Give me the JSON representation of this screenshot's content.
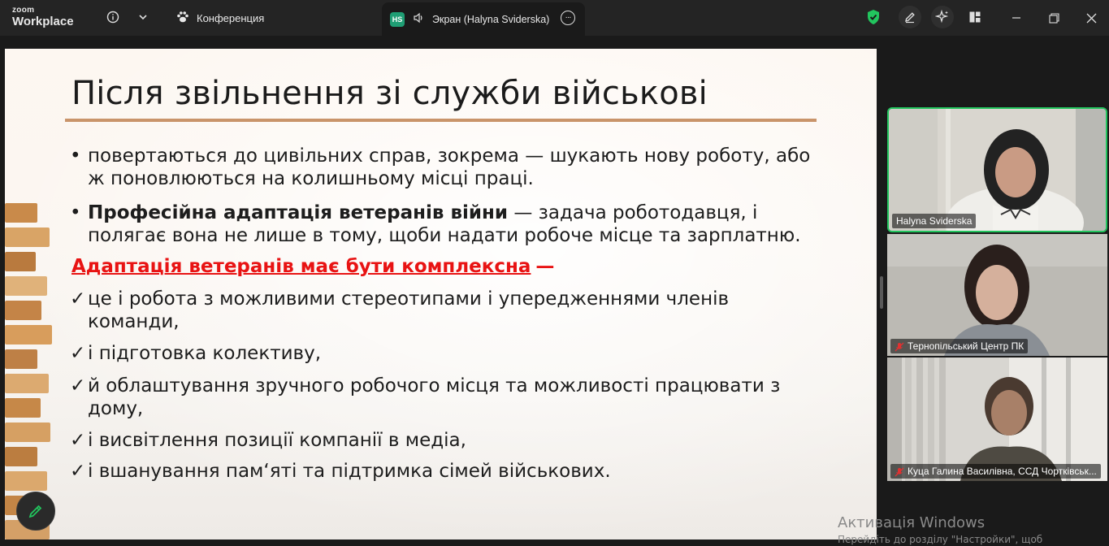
{
  "app": {
    "brand_line1": "zoom",
    "brand_line2": "Workplace"
  },
  "topbar": {
    "info_icon": "info-icon",
    "chevron_icon": "chevron-down-icon",
    "conference_tab": {
      "icon": "paw-icon",
      "label": "Конференция"
    },
    "screen_tab": {
      "badge": "HS",
      "icon": "speaker-icon",
      "label": "Экран (Halyna Sviderska)",
      "more": "···"
    },
    "actions": [
      "shield-check-icon",
      "pencil-icon",
      "ai-sparkle-icon",
      "layout-icon"
    ],
    "window_controls": [
      "minimize",
      "restore",
      "close"
    ]
  },
  "colors": {
    "accent_green": "#22c55e",
    "slide_red": "#e81313",
    "rule": "#c9946a"
  },
  "slide": {
    "title": "Після звільнення зі служби військові",
    "bullets": [
      {
        "marker": "•",
        "text": "повертаються до цивільних справ, зокрема — шукають нову роботу, або ж поновлюються на колишньому місці праці."
      },
      {
        "marker": "•",
        "bold": "Професійна адаптація ветеранів війни",
        "text": " — задача роботодавця, і полягає вона не лише в тому, щоби надати робоче місце та зарплатню."
      }
    ],
    "heading": "Адаптація ветеранів має бути комплексна",
    "heading_dash": "—",
    "checks": [
      {
        "marker": "✓",
        "text": "це і робота з можливими стереотипами і упередженнями членів команди,"
      },
      {
        "marker": "✓",
        "text": "і підготовка колективу,"
      },
      {
        "marker": "✓",
        "text": "й облаштування зручного робочого місця та можливості працювати з дому,"
      },
      {
        "marker": "✓",
        "text": "і висвітлення позиції компанії в медіа,"
      },
      {
        "marker": "✓",
        "text": "і вшанування пам‘яті та підтримка сімей військових."
      }
    ]
  },
  "participants": [
    {
      "name": "Halyna Sviderska",
      "muted": false,
      "active": true
    },
    {
      "name": "Тернопільський Центр ПК",
      "muted": true,
      "active": false
    },
    {
      "name": "Куца Галина Василівна, ССД Чортківськ...",
      "muted": true,
      "active": false
    }
  ],
  "watermark": {
    "line1": "Активація Windows",
    "line2": "Перейдіть до розділу \"Настройки\", щоб"
  }
}
